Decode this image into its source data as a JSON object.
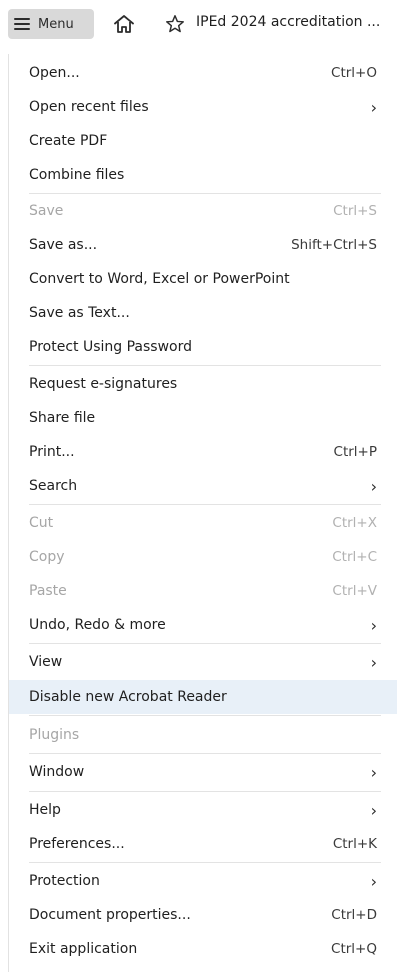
{
  "header": {
    "menu_label": "Menu",
    "document_title": "IPEd 2024 accreditation ..."
  },
  "menu": {
    "items": [
      {
        "label": "Open...",
        "shortcut": "Ctrl+O",
        "submenu": false,
        "enabled": true
      },
      {
        "label": "Open recent files",
        "shortcut": "",
        "submenu": true,
        "enabled": true
      },
      {
        "label": "Create PDF",
        "shortcut": "",
        "submenu": false,
        "enabled": true
      },
      {
        "label": "Combine files",
        "shortcut": "",
        "submenu": false,
        "enabled": true
      },
      {
        "label": "Save",
        "shortcut": "Ctrl+S",
        "submenu": false,
        "enabled": false
      },
      {
        "label": "Save as...",
        "shortcut": "Shift+Ctrl+S",
        "submenu": false,
        "enabled": true
      },
      {
        "label": "Convert to Word, Excel or PowerPoint",
        "shortcut": "",
        "submenu": false,
        "enabled": true
      },
      {
        "label": "Save as Text...",
        "shortcut": "",
        "submenu": false,
        "enabled": true
      },
      {
        "label": "Protect Using Password",
        "shortcut": "",
        "submenu": false,
        "enabled": true
      },
      {
        "label": "Request e-signatures",
        "shortcut": "",
        "submenu": false,
        "enabled": true
      },
      {
        "label": "Share file",
        "shortcut": "",
        "submenu": false,
        "enabled": true
      },
      {
        "label": "Print...",
        "shortcut": "Ctrl+P",
        "submenu": false,
        "enabled": true
      },
      {
        "label": "Search",
        "shortcut": "",
        "submenu": true,
        "enabled": true
      },
      {
        "label": "Cut",
        "shortcut": "Ctrl+X",
        "submenu": false,
        "enabled": false
      },
      {
        "label": "Copy",
        "shortcut": "Ctrl+C",
        "submenu": false,
        "enabled": false
      },
      {
        "label": "Paste",
        "shortcut": "Ctrl+V",
        "submenu": false,
        "enabled": false
      },
      {
        "label": "Undo, Redo & more",
        "shortcut": "",
        "submenu": true,
        "enabled": true
      },
      {
        "label": "View",
        "shortcut": "",
        "submenu": true,
        "enabled": true
      },
      {
        "label": "Disable new Acrobat Reader",
        "shortcut": "",
        "submenu": false,
        "enabled": true,
        "highlighted": true
      },
      {
        "label": "Plugins",
        "shortcut": "",
        "submenu": false,
        "enabled": false
      },
      {
        "label": "Window",
        "shortcut": "",
        "submenu": true,
        "enabled": true
      },
      {
        "label": "Help",
        "shortcut": "",
        "submenu": true,
        "enabled": true
      },
      {
        "label": "Preferences...",
        "shortcut": "Ctrl+K",
        "submenu": false,
        "enabled": true
      },
      {
        "label": "Protection",
        "shortcut": "",
        "submenu": true,
        "enabled": true
      },
      {
        "label": "Document properties...",
        "shortcut": "Ctrl+D",
        "submenu": false,
        "enabled": true
      },
      {
        "label": "Exit application",
        "shortcut": "Ctrl+Q",
        "submenu": false,
        "enabled": true
      }
    ]
  },
  "colors": {
    "highlight": "#e8f0f8",
    "disabled_text": "#a6a6a6",
    "menu_button_bg": "#d9d9d9"
  }
}
